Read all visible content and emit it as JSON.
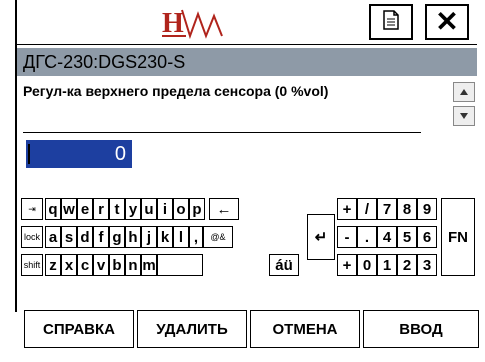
{
  "header": {
    "logo_text": "HW",
    "doc_icon": "document-icon",
    "close_icon": "close-icon",
    "close_glyph": "✕"
  },
  "titlebar": {
    "title": "ДГС-230:DGS230-S"
  },
  "prompt": {
    "text": "Регул-ка верхнего предела сенсора (0 %vol)"
  },
  "input": {
    "value": "0"
  },
  "keyboard": {
    "row1": [
      "q",
      "w",
      "e",
      "r",
      "t",
      "y",
      "u",
      "i",
      "o",
      "p"
    ],
    "row2": [
      "a",
      "s",
      "d",
      "f",
      "g",
      "h",
      "j",
      "k",
      "l"
    ],
    "row3": [
      "z",
      "x",
      "c",
      "v",
      "b",
      "n",
      "m"
    ],
    "numpad_row1": [
      "+",
      "/",
      "7",
      "8",
      "9"
    ],
    "numpad_row2": [
      "-",
      ".",
      "4",
      "5",
      "6"
    ],
    "numpad_row3": [
      "+",
      "0",
      "1",
      "2",
      "3"
    ],
    "tab_label": "⇥",
    "lock_label": "lock",
    "shift_label": "shift",
    "backspace_label": "←",
    "enter_label": "↵",
    "at_amp_label": "@&",
    "accent_label": "áü",
    "fn_label": "FN",
    "comma_label": ","
  },
  "buttons": {
    "help": "СПРАВКА",
    "delete": "УДАЛИТЬ",
    "cancel": "ОТМЕНА",
    "enter": "ВВОД"
  }
}
